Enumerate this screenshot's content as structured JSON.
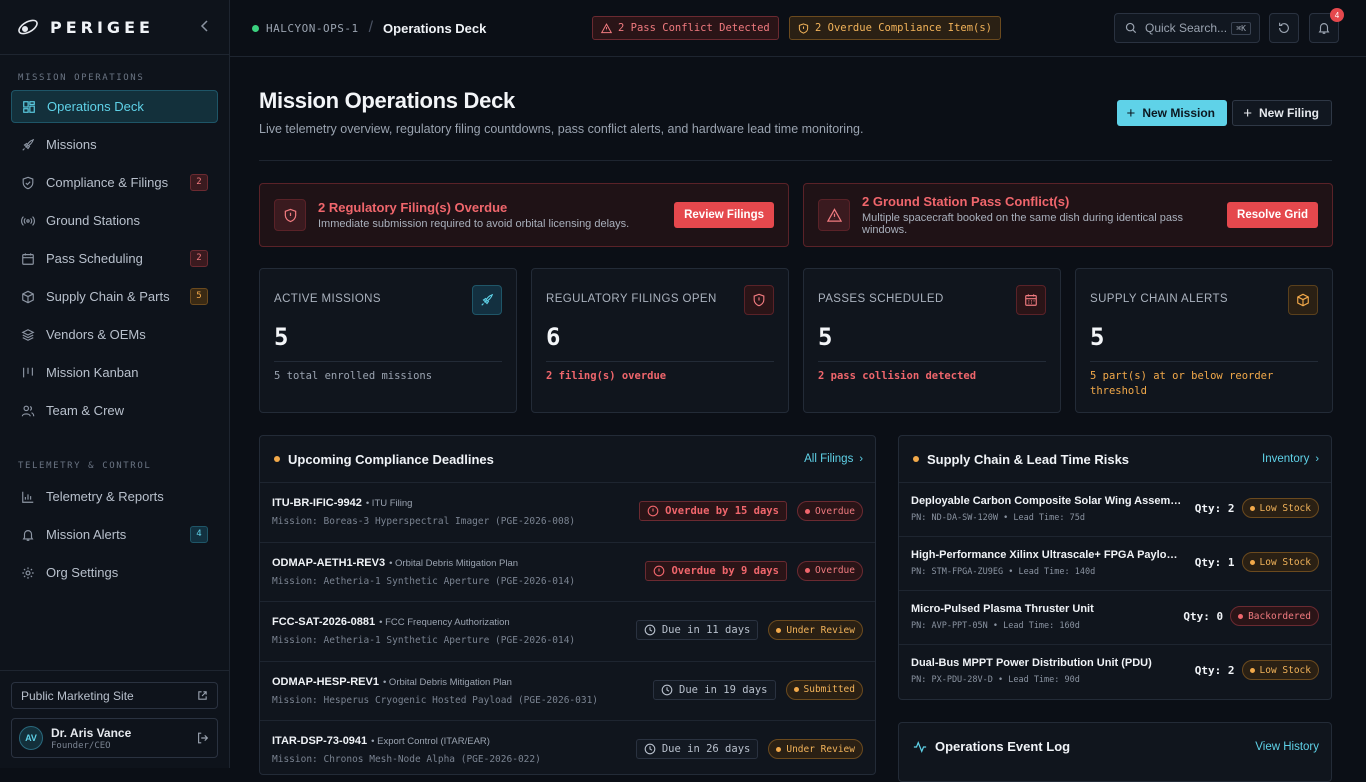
{
  "brand": {
    "name": "PERIGEE"
  },
  "sidebar": {
    "sections": [
      {
        "title": "MISSION OPERATIONS"
      },
      {
        "title": "TELEMETRY & CONTROL"
      }
    ],
    "items": [
      {
        "label": "Operations Deck",
        "badge": ""
      },
      {
        "label": "Missions",
        "badge": ""
      },
      {
        "label": "Compliance & Filings",
        "badge": "2"
      },
      {
        "label": "Ground Stations",
        "badge": ""
      },
      {
        "label": "Pass Scheduling",
        "badge": "2"
      },
      {
        "label": "Supply Chain & Parts",
        "badge": "5"
      },
      {
        "label": "Vendors & OEMs",
        "badge": ""
      },
      {
        "label": "Mission Kanban",
        "badge": ""
      },
      {
        "label": "Team & Crew",
        "badge": ""
      },
      {
        "label": "Telemetry & Reports",
        "badge": ""
      },
      {
        "label": "Mission Alerts",
        "badge": "4"
      },
      {
        "label": "Org Settings",
        "badge": ""
      }
    ],
    "marketing_label": "Public Marketing Site",
    "user": {
      "initials": "AV",
      "name": "Dr. Aris Vance",
      "role": "Founder/CEO"
    }
  },
  "topbar": {
    "workspace": "HALCYON-OPS-1",
    "separator": "/",
    "crumb": "Operations Deck",
    "conflict_chip": "2 Pass Conflict Detected",
    "compliance_chip": "2 Overdue Compliance Item(s)",
    "search_placeholder": "Quick Search...",
    "search_shortcut": "⌘K",
    "notification_count": "4"
  },
  "page": {
    "title": "Mission Operations Deck",
    "subtitle": "Live telemetry overview, regulatory filing countdowns, pass conflict alerts, and hardware lead time monitoring.",
    "new_mission_label": "New Mission",
    "new_filing_label": "New Filing"
  },
  "banners": [
    {
      "title": "2 Regulatory Filing(s) Overdue",
      "desc": "Immediate submission required to avoid orbital licensing delays.",
      "action": "Review Filings"
    },
    {
      "title": "2 Ground Station Pass Conflict(s)",
      "desc": "Multiple spacecraft booked on the same dish during identical pass windows.",
      "action": "Resolve Grid"
    }
  ],
  "stats": [
    {
      "label": "ACTIVE MISSIONS",
      "value": "5",
      "note": "5 total enrolled missions"
    },
    {
      "label": "REGULATORY FILINGS OPEN",
      "value": "6",
      "note": "2 filing(s) overdue"
    },
    {
      "label": "PASSES SCHEDULED",
      "value": "5",
      "note": "2 pass collision detected"
    },
    {
      "label": "SUPPLY CHAIN ALERTS",
      "value": "5",
      "note": "5 part(s) at or below reorder threshold"
    }
  ],
  "deadlines": {
    "title": "Upcoming Compliance Deadlines",
    "link": "All Filings",
    "rows": [
      {
        "id": "ITU-BR-IFIC-9942",
        "type": "• ITU Filing",
        "mission": "Mission: Boreas-3 Hyperspectral Imager (PGE-2026-008)",
        "due": "Overdue by 15 days",
        "status": "Overdue"
      },
      {
        "id": "ODMAP-AETH1-REV3",
        "type": "• Orbital Debris Mitigation Plan",
        "mission": "Mission: Aetheria-1 Synthetic Aperture (PGE-2026-014)",
        "due": "Overdue by 9 days",
        "status": "Overdue"
      },
      {
        "id": "FCC-SAT-2026-0881",
        "type": "• FCC Frequency Authorization",
        "mission": "Mission: Aetheria-1 Synthetic Aperture (PGE-2026-014)",
        "due": "Due in 11 days",
        "status": "Under Review"
      },
      {
        "id": "ODMAP-HESP-REV1",
        "type": "• Orbital Debris Mitigation Plan",
        "mission": "Mission: Hesperus Cryogenic Hosted Payload (PGE-2026-031)",
        "due": "Due in 19 days",
        "status": "Submitted"
      },
      {
        "id": "ITAR-DSP-73-0941",
        "type": "• Export Control (ITAR/EAR)",
        "mission": "Mission: Chronos Mesh-Node Alpha (PGE-2026-022)",
        "due": "Due in 26 days",
        "status": "Under Review"
      }
    ]
  },
  "supply": {
    "title": "Supply Chain & Lead Time Risks",
    "link": "Inventory",
    "rows": [
      {
        "name": "Deployable Carbon Composite Solar Wing Assembly",
        "meta": "PN: ND-DA-SW-120W • Lead Time: 75d",
        "qty": "Qty: 2",
        "status": "Low Stock"
      },
      {
        "name": "High-Performance Xilinx Ultrascale+ FPGA Payload Processor",
        "meta": "PN: STM-FPGA-ZU9EG • Lead Time: 140d",
        "qty": "Qty: 1",
        "status": "Low Stock"
      },
      {
        "name": "Micro-Pulsed Plasma Thruster Unit",
        "meta": "PN: AVP-PPT-05N • Lead Time: 160d",
        "qty": "Qty: 0",
        "status": "Backordered"
      },
      {
        "name": "Dual-Bus MPPT Power Distribution Unit (PDU)",
        "meta": "PN: PX-PDU-28V-D • Lead Time: 90d",
        "qty": "Qty: 2",
        "status": "Low Stock"
      }
    ]
  },
  "eventlog": {
    "title": "Operations Event Log",
    "link": "View History"
  }
}
